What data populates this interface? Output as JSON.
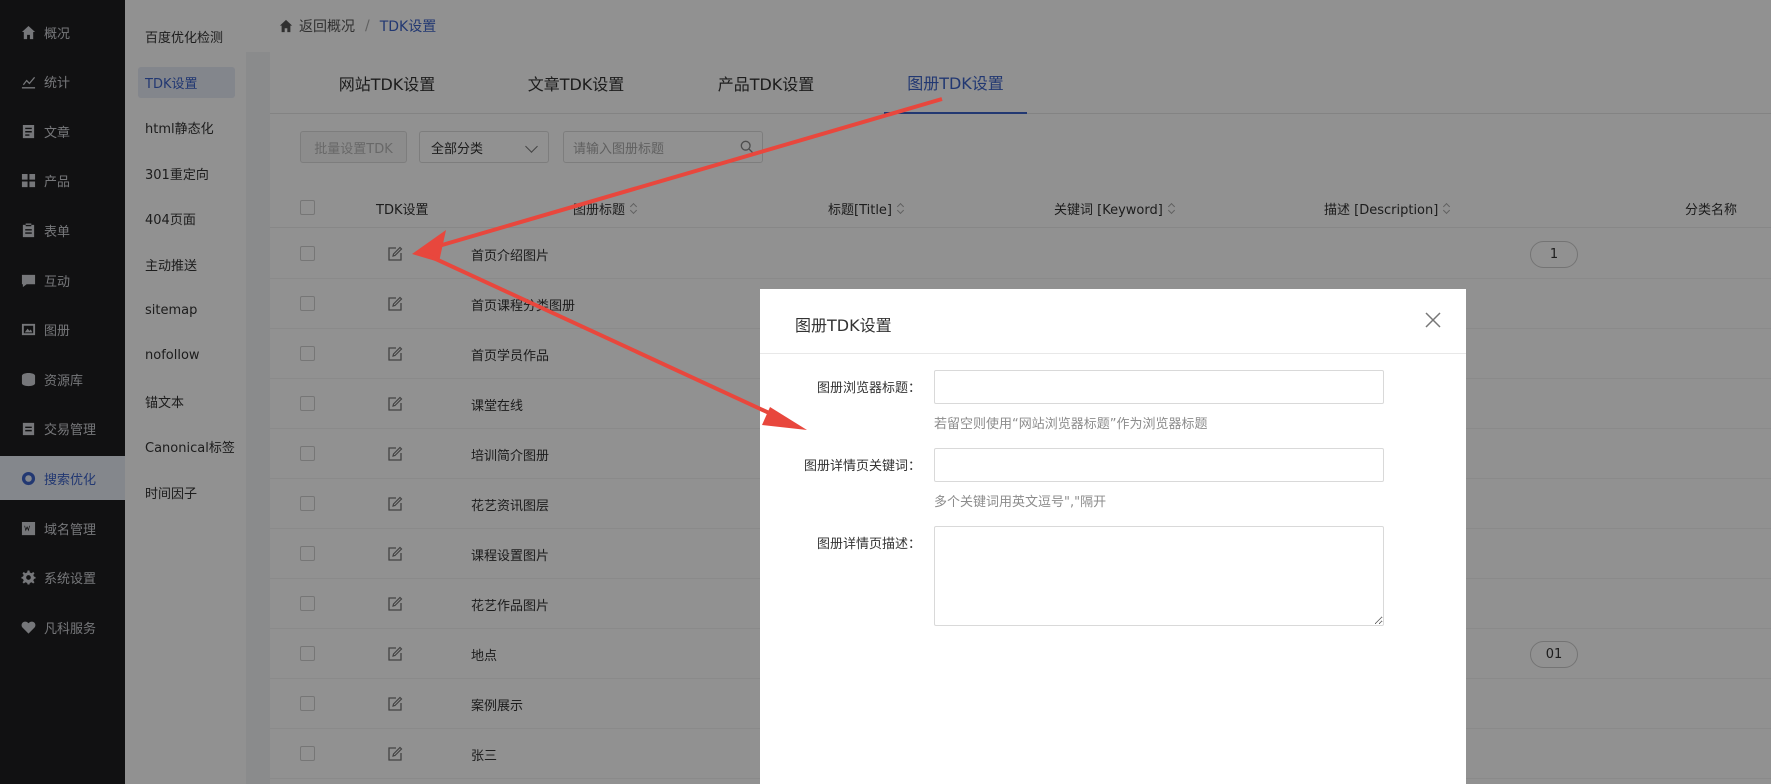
{
  "colors": {
    "accent": "#3d63c8",
    "arrow": "#e8473d",
    "sidebar_bg": "#1f1f20"
  },
  "nav": [
    {
      "label": "概况",
      "icon": "home-icon"
    },
    {
      "label": "统计",
      "icon": "chart-icon"
    },
    {
      "label": "文章",
      "icon": "article-icon"
    },
    {
      "label": "产品",
      "icon": "product-icon"
    },
    {
      "label": "表单",
      "icon": "form-icon"
    },
    {
      "label": "互动",
      "icon": "chat-icon"
    },
    {
      "label": "图册",
      "icon": "album-icon"
    },
    {
      "label": "资源库",
      "icon": "database-icon"
    },
    {
      "label": "交易管理",
      "icon": "trade-icon"
    },
    {
      "label": "搜索优化",
      "icon": "seo-icon",
      "active": true
    },
    {
      "label": "域名管理",
      "icon": "domain-icon"
    },
    {
      "label": "系统设置",
      "icon": "gear-icon"
    },
    {
      "label": "凡科服务",
      "icon": "heart-icon"
    }
  ],
  "sub_nav": [
    {
      "label": "百度优化检测"
    },
    {
      "label": "TDK设置",
      "active": true
    },
    {
      "label": "html静态化"
    },
    {
      "label": "301重定向"
    },
    {
      "label": "404页面"
    },
    {
      "label": "主动推送"
    },
    {
      "label": "sitemap"
    },
    {
      "label": "nofollow"
    },
    {
      "label": "锚文本"
    },
    {
      "label": "Canonical标签"
    },
    {
      "label": "时间因子"
    }
  ],
  "breadcrumb": {
    "back": "返回概况",
    "sep": "/",
    "current": "TDK设置"
  },
  "tabs": [
    {
      "label": "网站TDK设置"
    },
    {
      "label": "文章TDK设置"
    },
    {
      "label": "产品TDK设置"
    },
    {
      "label": "图册TDK设置",
      "active": true
    }
  ],
  "toolbar": {
    "batch_label": "批量设置TDK",
    "category_value": "全部分类",
    "search_placeholder": "请输入图册标题"
  },
  "table": {
    "headers": {
      "tdk": "TDK设置",
      "album_title": "图册标题",
      "title": "标题[Title]",
      "keyword": "关键词 [Keyword]",
      "description": "描述 [Description]",
      "category": "分类名称"
    },
    "rows": [
      {
        "name": "首页介绍图片",
        "category": "1"
      },
      {
        "name": "首页课程分类图册",
        "category": ""
      },
      {
        "name": "首页学员作品",
        "category": ""
      },
      {
        "name": "课堂在线",
        "category": ""
      },
      {
        "name": "培训简介图册",
        "category": ""
      },
      {
        "name": "花艺资讯图层",
        "category": ""
      },
      {
        "name": "课程设置图片",
        "category": ""
      },
      {
        "name": "花艺作品图片",
        "category": ""
      },
      {
        "name": "地点",
        "category": "01"
      },
      {
        "name": "案例展示",
        "category": ""
      },
      {
        "name": "张三",
        "category": ""
      }
    ]
  },
  "modal": {
    "title": "图册TDK设置",
    "fields": {
      "browser_title_label": "图册浏览器标题：",
      "browser_title_value": "",
      "browser_title_hint": "若留空则使用“网站浏览器标题”作为浏览器标题",
      "keywords_label": "图册详情页关键词：",
      "keywords_value": "",
      "keywords_hint": "多个关键词用英文逗号\",\"隔开",
      "description_label": "图册详情页描述：",
      "description_value": ""
    }
  }
}
